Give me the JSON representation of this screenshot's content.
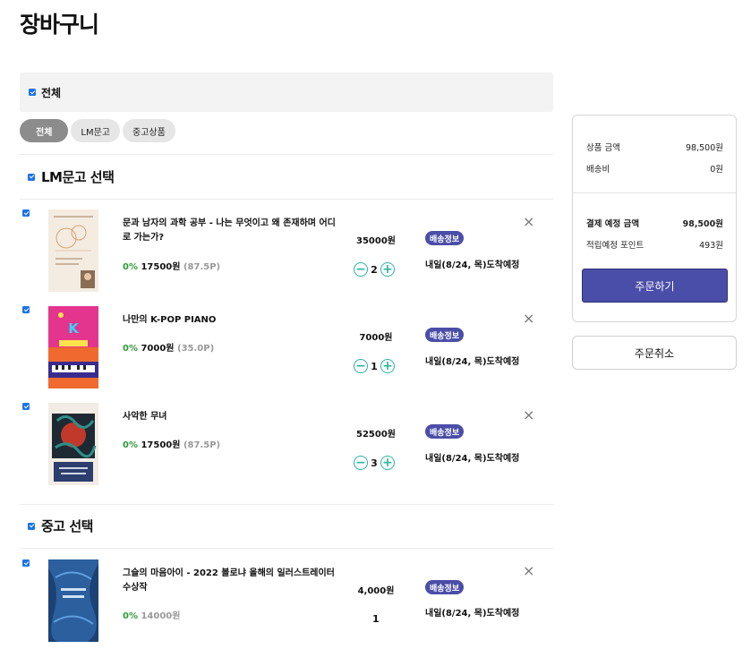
{
  "page": {
    "title": "장바구니"
  },
  "select_all": {
    "label": "전체",
    "checked": true
  },
  "filters": [
    {
      "label": "전체",
      "active": true
    },
    {
      "label": "LM문고",
      "active": false
    },
    {
      "label": "중고상품",
      "active": false
    }
  ],
  "sections": {
    "lm": {
      "label": "LM문고 선택",
      "checked": true
    },
    "used": {
      "label": "중고 선택",
      "checked": true
    }
  },
  "items": [
    {
      "title": "문과 남자의 과학 공부 - 나는 무엇이고 왜 존재하며 어디로 가는가?",
      "discount": "0%",
      "price": "17500원",
      "points": "(87.5P)",
      "unit_total": "35000원",
      "quantity": "2",
      "badge": "배송정보",
      "arrival": "내일(8/24, 목)도착예정",
      "checked": true
    },
    {
      "title": "나만의 K-POP PIANO",
      "discount": "0%",
      "price": "7000원",
      "points": "(35.0P)",
      "unit_total": "7000원",
      "quantity": "1",
      "badge": "배송정보",
      "arrival": "내일(8/24, 목)도착예정",
      "checked": true
    },
    {
      "title": "사악한 무녀",
      "discount": "0%",
      "price": "17500원",
      "points": "(87.5P)",
      "unit_total": "52500원",
      "quantity": "3",
      "badge": "배송정보",
      "arrival": "내일(8/24, 목)도착예정",
      "checked": true
    },
    {
      "title": "그슬의 마음아이 - 2022 볼로냐 올해의 일러스트레이터 수상작",
      "discount": "0%",
      "price": "14000원",
      "unit_total": "4,000원",
      "quantity": "1",
      "badge": "배송정보",
      "arrival": "내일(8/24, 목)도착예정",
      "checked": true
    }
  ],
  "summary": {
    "product_amount_label": "상품 금액",
    "product_amount": "98,500원",
    "shipping_label": "배송비",
    "shipping": "0원",
    "total_label": "결제 예정 금액",
    "total": "98,500원",
    "points_label": "적립예정 포인트",
    "points": "493원",
    "order_button": "주문하기",
    "cancel_button": "주문취소"
  },
  "icons": {
    "remove": "×",
    "minus": "−",
    "plus": "+"
  },
  "colors": {
    "accent": "#4b4ea8",
    "checkbox": "#1a73e8",
    "discount": "#2e9b38",
    "stepper": "#2bb3a3"
  }
}
